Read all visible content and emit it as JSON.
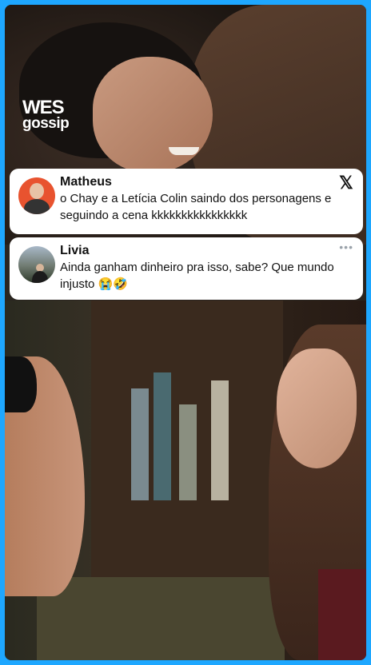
{
  "brand": {
    "line1": "WES",
    "line2": "gossip"
  },
  "comments": [
    {
      "author": "Matheus",
      "text": "o Chay e a Letícia Colin saindo dos personagens e seguindo a cena kkkkkkkkkkkkkkkk",
      "platform_icon": "x-logo-icon"
    },
    {
      "author": "Livia",
      "text": "Ainda ganham dinheiro pra isso, sabe? Que mundo injusto 😭🤣",
      "menu_icon": "more-options-icon"
    }
  ],
  "colors": {
    "frame": "#1ea7ff",
    "card": "#ffffff"
  }
}
